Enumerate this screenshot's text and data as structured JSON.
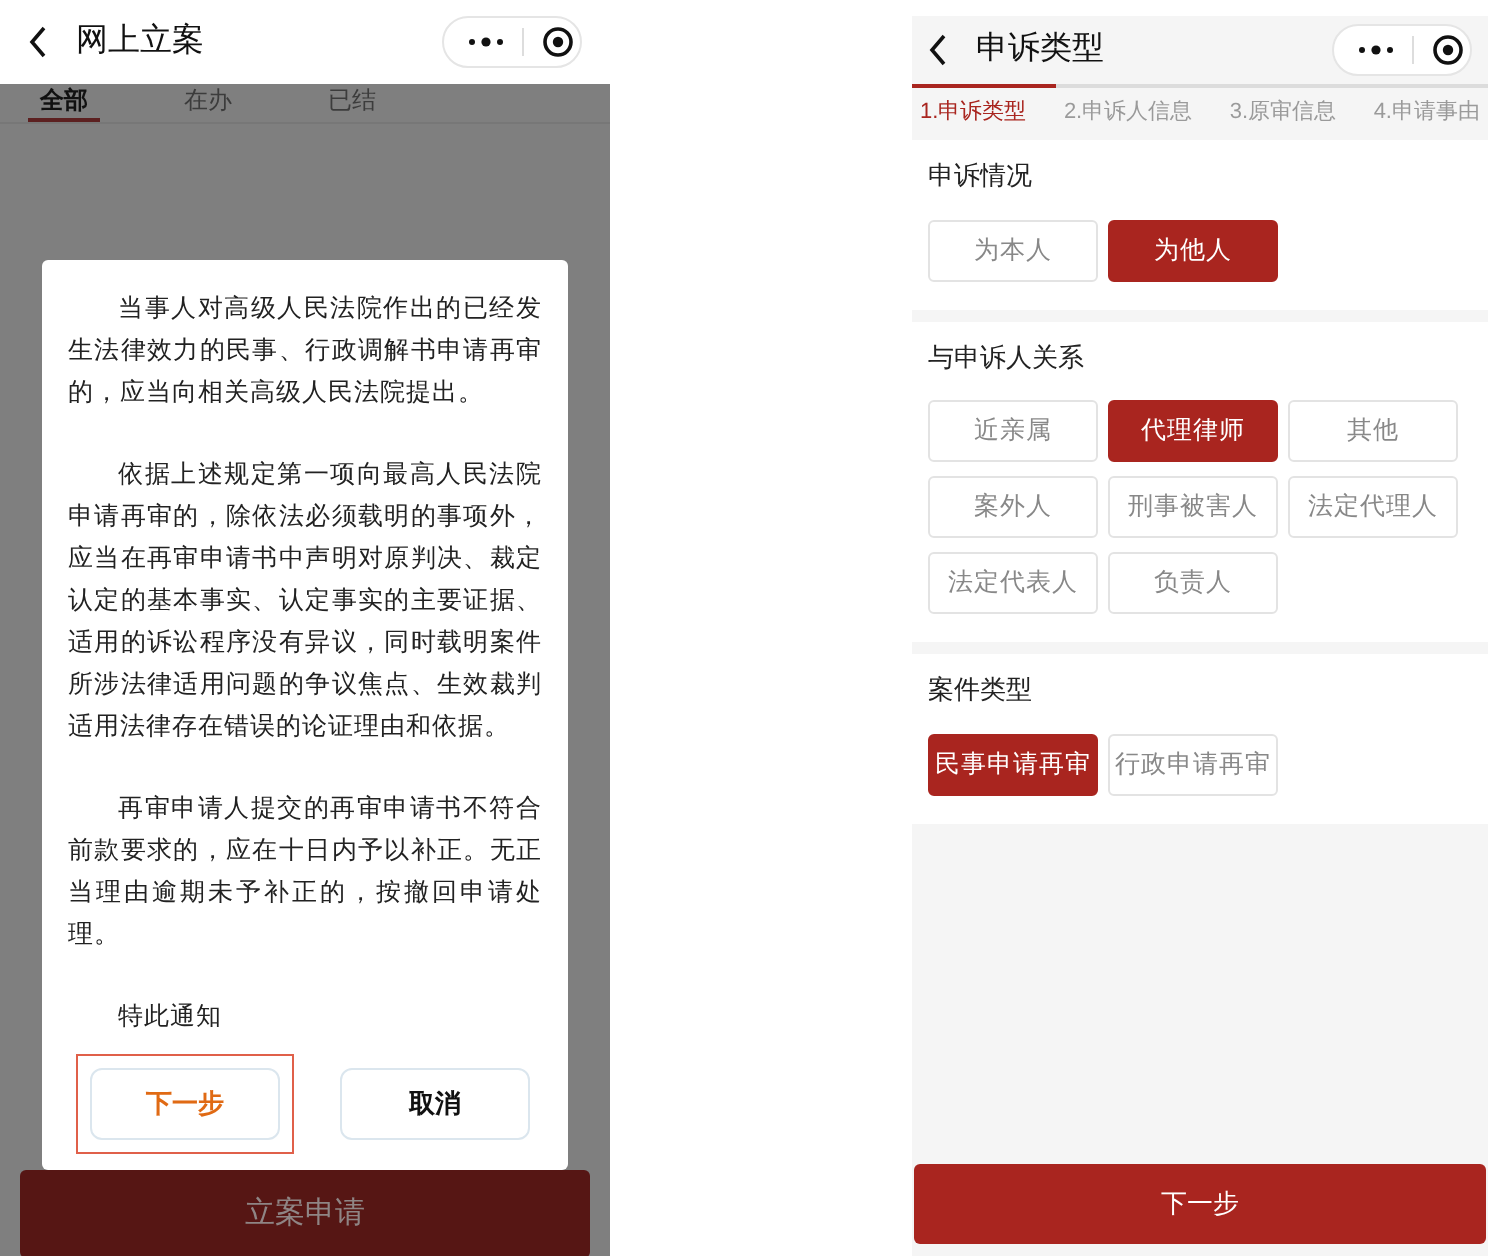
{
  "left_screen": {
    "title": "网上立案",
    "tabs": [
      {
        "label": "全部",
        "selected": true
      },
      {
        "label": "在办",
        "selected": false
      },
      {
        "label": "已结",
        "selected": false
      }
    ],
    "dialog": {
      "paragraphs": [
        "当事人对高级人民法院作出的已经发生法律效力的民事、行政调解书申请再审的，应当向相关高级人民法院提出。",
        "依据上述规定第一项向最高人民法院申请再审的，除依法必须载明的事项外，应当在再审申请书中声明对原判决、裁定认定的基本事实、认定事实的主要证据、适用的诉讼程序没有异议，同时载明案件所涉法律适用问题的争议焦点、生效裁判适用法律存在错误的论证理由和依据。",
        "再审申请人提交的再审申请书不符合前款要求的，应在十日内予以补正。无正当理由逾期未予补正的，按撤回申请处理。"
      ],
      "closing": "特此通知",
      "buttons": [
        {
          "label": "下一步",
          "kind": "primary",
          "highlighted": true
        },
        {
          "label": "取消",
          "kind": "secondary",
          "highlighted": false
        }
      ]
    },
    "bottom_button": "立案申请"
  },
  "right_screen": {
    "title": "申诉类型",
    "progress": {
      "level": 0.25
    },
    "steps": [
      {
        "label": "1.申诉类型",
        "selected": true
      },
      {
        "label": "2.申诉人信息",
        "selected": false
      },
      {
        "label": "3.原审信息",
        "selected": false
      },
      {
        "label": "4.申请事由",
        "selected": false
      }
    ],
    "sections": [
      {
        "title": "申诉情况",
        "options": [
          {
            "label": "为本人",
            "selected": false
          },
          {
            "label": "为他人",
            "selected": true
          }
        ]
      },
      {
        "title": "与申诉人关系",
        "options": [
          {
            "label": "近亲属",
            "selected": false
          },
          {
            "label": "代理律师",
            "selected": true
          },
          {
            "label": "其他",
            "selected": false
          },
          {
            "label": "案外人",
            "selected": false
          },
          {
            "label": "刑事被害人",
            "selected": false
          },
          {
            "label": "法定代理人",
            "selected": false
          },
          {
            "label": "法定代表人",
            "selected": false
          },
          {
            "label": "负责人",
            "selected": false
          }
        ]
      },
      {
        "title": "案件类型",
        "options": [
          {
            "label": "民事申请再审",
            "selected": true
          },
          {
            "label": "行政申请再审",
            "selected": false
          }
        ]
      }
    ],
    "next_button": "下一步"
  }
}
